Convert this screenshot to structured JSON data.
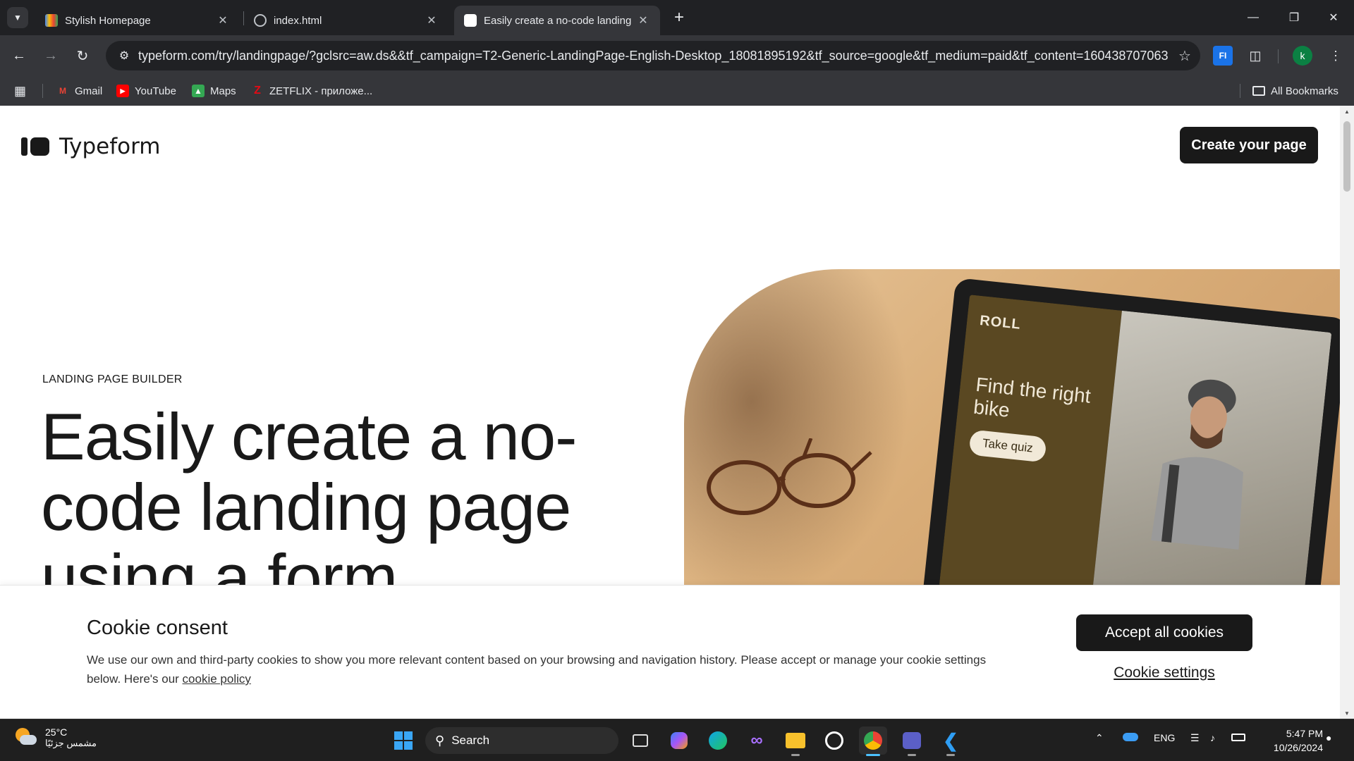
{
  "browser": {
    "tabs": [
      {
        "title": "Stylish Homepage",
        "favicon": "colorful-app-icon"
      },
      {
        "title": "index.html",
        "favicon": "globe-icon"
      },
      {
        "title": "Easily create a no-code landing",
        "favicon": "typeform-icon",
        "active": true
      }
    ],
    "url": "typeform.com/try/landingpage/?gclsrc=aw.ds&&tf_campaign=T2-Generic-LandingPage-English-Desktop_18081895192&tf_source=google&tf_medium=paid&tf_content=160438707063...",
    "extension_label": "FI",
    "profile_initial": "k",
    "bookmarks": [
      {
        "label": "Gmail",
        "icon": "gmail-icon",
        "color": "#ea4335"
      },
      {
        "label": "YouTube",
        "icon": "youtube-icon",
        "color": "#ff0000"
      },
      {
        "label": "Maps",
        "icon": "maps-icon",
        "color": "#34a853"
      },
      {
        "label": "ZETFLIX - приложе...",
        "icon": "zetflix-icon",
        "color": "#e50914"
      }
    ],
    "all_bookmarks": "All Bookmarks"
  },
  "page": {
    "brand": "Typeform",
    "cta": "Create your page",
    "eyebrow": "LANDING PAGE BUILDER",
    "headline": "Easily create a no-code landing page using a form",
    "hero_screen": {
      "brand": "ROLL",
      "text": "Find the right bike",
      "button": "Take quiz"
    }
  },
  "cookie": {
    "title": "Cookie consent",
    "text": "We use our own and third-party cookies to show you more relevant content based on your browsing and navigation history. Please accept or manage your cookie settings below. Here's our",
    "link": "cookie policy",
    "accept": "Accept all cookies",
    "settings": "Cookie settings"
  },
  "taskbar": {
    "weather_temp": "25°C",
    "weather_desc": "مشمس جزئيًا",
    "search": "Search",
    "lang": "ENG",
    "time": "5:47 PM",
    "date": "10/26/2024"
  },
  "colors": {
    "brand_dark": "#191919",
    "chrome_bg": "#202124",
    "chrome_toolbar": "#35363a"
  }
}
